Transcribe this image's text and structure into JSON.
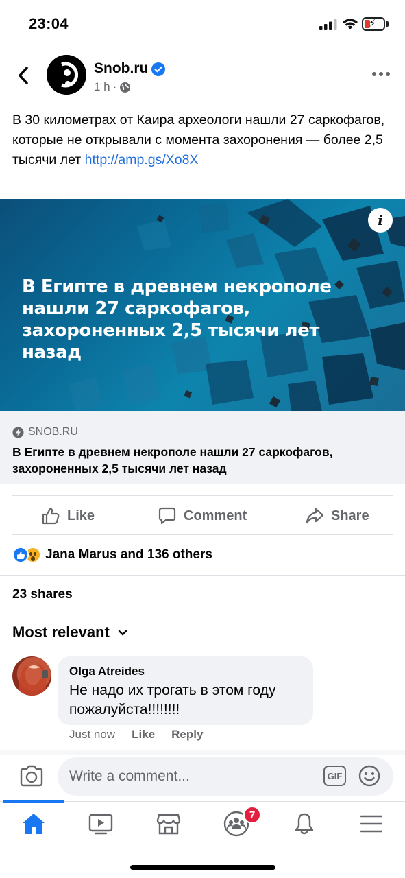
{
  "status_bar": {
    "time": "23:04"
  },
  "post": {
    "page_name": "Snob.ru",
    "time_ago": "1 h",
    "separator": "·",
    "text": "В 30 километрах от Каира археологи нашли 27 саркофагов, которые не открывали с момента захоронения — более 2,5 тысячи лет ",
    "link_text": "http://amp.gs/Xo8X",
    "image_headline": "В Египте в древнем некрополе нашли 27 саркофагов, захороненных 2,5 тысячи лет назад",
    "info_label": "i",
    "link_domain": "SNOB.RU",
    "link_title": "В Египте в древнем некрополе нашли 27 саркофагов, захороненных 2,5 тысячи лет назад"
  },
  "actions": {
    "like": "Like",
    "comment": "Comment",
    "share": "Share"
  },
  "reactions": {
    "summary": "Jana Marus and 136 others"
  },
  "shares": "23 shares",
  "sort_label": "Most relevant",
  "comment": {
    "author": "Olga Atreides",
    "text": "Не надо их трогать в этом году пожалуйста!!!!!!!!",
    "time": "Just now",
    "like": "Like",
    "reply": "Reply"
  },
  "composer": {
    "placeholder": "Write a comment...",
    "gif_label": "GIF"
  },
  "tab_bar": {
    "groups_badge": "7"
  },
  "colors": {
    "brand_blue": "#1877f2",
    "link_blue": "#216fdb",
    "secondary_text": "#65676b",
    "badge_red": "#e41e3f"
  }
}
